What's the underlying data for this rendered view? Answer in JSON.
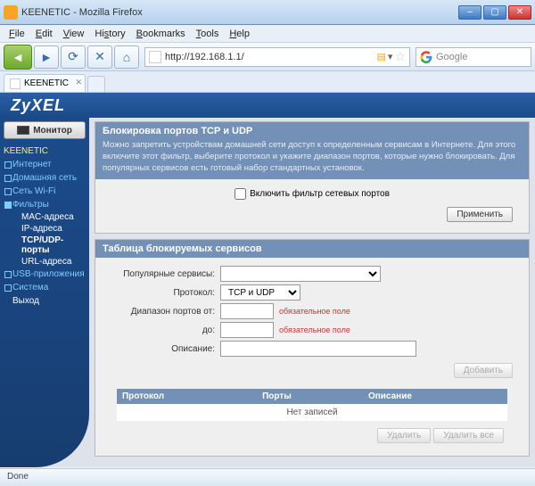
{
  "window": {
    "title": "KEENETIC - Mozilla Firefox"
  },
  "menu": {
    "file": "File",
    "edit": "Edit",
    "view": "View",
    "history": "History",
    "bookmarks": "Bookmarks",
    "tools": "Tools",
    "help": "Help"
  },
  "toolbar": {
    "url": "http://192.168.1.1/",
    "search_placeholder": "Google"
  },
  "tab": {
    "title": "KEENETIC"
  },
  "brand": "ZyXEL",
  "sidebar": {
    "monitor": "Монитор",
    "root": "KEENETIC",
    "items": [
      {
        "label": "Интернет",
        "expandable": true
      },
      {
        "label": "Домашняя сеть",
        "expandable": true
      },
      {
        "label": "Сеть Wi-Fi",
        "expandable": true
      },
      {
        "label": "Фильтры",
        "expandable": true,
        "expanded": true,
        "children": [
          {
            "label": "MAC-адреса"
          },
          {
            "label": "IP-адреса"
          },
          {
            "label": "TCP/UDP-порты",
            "active": true
          },
          {
            "label": "URL-адреса"
          }
        ]
      },
      {
        "label": "USB-приложения",
        "expandable": true
      },
      {
        "label": "Система",
        "expandable": true
      },
      {
        "label": "Выход",
        "expandable": false
      }
    ]
  },
  "panel1": {
    "title": "Блокировка портов TCP и UDP",
    "desc": "Можно запретить устройствам домашней сети доступ к определенным сервисам в Интернете. Для этого включите этот фильтр, выберите протокол и укажите диапазон портов, которые нужно блокировать. Для популярных сервисов есть готовый набор стандартных установок.",
    "checkbox_label": "Включить фильтр сетевых портов",
    "apply": "Применить"
  },
  "panel2": {
    "title": "Таблица блокируемых сервисов",
    "labels": {
      "popular": "Популярные сервисы:",
      "protocol": "Протокол:",
      "port_from": "Диапазон портов от:",
      "port_to": "до:",
      "description": "Описание:"
    },
    "protocol_value": "TCP и UDP",
    "required": "обязательное поле",
    "add": "Добавить",
    "table": {
      "col_proto": "Протокол",
      "col_ports": "Порты",
      "col_desc": "Описание",
      "empty": "Нет записей"
    },
    "delete": "Удалить",
    "delete_all": "Удалить все"
  },
  "status": "Done"
}
